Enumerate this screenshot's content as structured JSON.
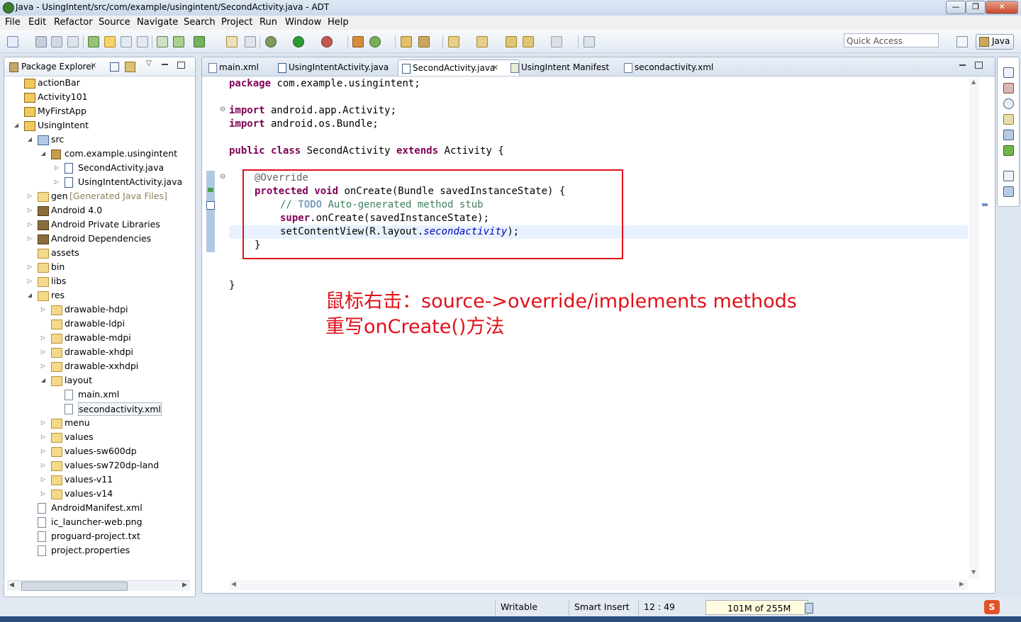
{
  "window": {
    "title": "Java - UsingIntent/src/com/example/usingintent/SecondActivity.java - ADT",
    "minimize": "—",
    "restore": "❐",
    "close": "✕"
  },
  "menubar": [
    "File",
    "Edit",
    "Refactor",
    "Source",
    "Navigate",
    "Search",
    "Project",
    "Run",
    "Window",
    "Help"
  ],
  "toolbar": {
    "quick_access_placeholder": "Quick Access",
    "perspective": "Java"
  },
  "package_explorer": {
    "title": "Package Explorer",
    "close": "✕",
    "tree": [
      {
        "label": "actionBar",
        "kind": "project"
      },
      {
        "label": "Activity101",
        "kind": "project"
      },
      {
        "label": "MyFirstApp",
        "kind": "project"
      },
      {
        "label": "UsingIntent",
        "kind": "project"
      },
      {
        "label": "src",
        "kind": "srcfolder"
      },
      {
        "label": "com.example.usingintent",
        "kind": "package"
      },
      {
        "label": "SecondActivity.java",
        "kind": "java"
      },
      {
        "label": "UsingIntentActivity.java",
        "kind": "java"
      },
      {
        "label": "gen",
        "kind": "folder",
        "suffix": "[Generated Java Files]"
      },
      {
        "label": "Android 4.0",
        "kind": "lib"
      },
      {
        "label": "Android Private Libraries",
        "kind": "lib"
      },
      {
        "label": "Android Dependencies",
        "kind": "lib"
      },
      {
        "label": "assets",
        "kind": "folder"
      },
      {
        "label": "bin",
        "kind": "folder"
      },
      {
        "label": "libs",
        "kind": "folder"
      },
      {
        "label": "res",
        "kind": "folder"
      },
      {
        "label": "drawable-hdpi",
        "kind": "folder"
      },
      {
        "label": "drawable-ldpi",
        "kind": "folder"
      },
      {
        "label": "drawable-mdpi",
        "kind": "folder"
      },
      {
        "label": "drawable-xhdpi",
        "kind": "folder"
      },
      {
        "label": "drawable-xxhdpi",
        "kind": "folder"
      },
      {
        "label": "layout",
        "kind": "folder"
      },
      {
        "label": "main.xml",
        "kind": "file"
      },
      {
        "label": "secondactivity.xml",
        "kind": "file"
      },
      {
        "label": "menu",
        "kind": "folder"
      },
      {
        "label": "values",
        "kind": "folder"
      },
      {
        "label": "values-sw600dp",
        "kind": "folder"
      },
      {
        "label": "values-sw720dp-land",
        "kind": "folder"
      },
      {
        "label": "values-v11",
        "kind": "folder"
      },
      {
        "label": "values-v14",
        "kind": "folder"
      },
      {
        "label": "AndroidManifest.xml",
        "kind": "file"
      },
      {
        "label": "ic_launcher-web.png",
        "kind": "file"
      },
      {
        "label": "proguard-project.txt",
        "kind": "file"
      },
      {
        "label": "project.properties",
        "kind": "file"
      }
    ]
  },
  "editor": {
    "tabs": [
      {
        "label": "main.xml"
      },
      {
        "label": "UsingIntentActivity.java"
      },
      {
        "label": "SecondActivity.java",
        "active": true,
        "close": "✕"
      },
      {
        "label": "UsingIntent Manifest"
      },
      {
        "label": "secondactivity.xml"
      }
    ],
    "code": {
      "l1_kw": "package",
      "l1_rest": " com.example.usingintent;",
      "l3_kw": "import",
      "l3_rest": " android.app.Activity;",
      "l4_kw": "import",
      "l4_rest": " android.os.Bundle;",
      "l6_kw1": "public class",
      "l6_mid": " SecondActivity ",
      "l6_kw2": "extends",
      "l6_rest": " Activity {",
      "l8_an": "@Override",
      "l9_kw": "protected void",
      "l9_rest": " onCreate(Bundle savedInstanceState) {",
      "l10_cm1": "// ",
      "l10_todo": "TODO",
      "l10_cm2": " Auto-generated method stub",
      "l11_kw": "super",
      "l11_rest": ".onCreate(savedInstanceState);",
      "l12_a": "setContentView(R.layout.",
      "l12_it": "secondactivity",
      "l12_b": ");",
      "l13": "}",
      "l15": "}"
    },
    "annotation_line1": "鼠标右击：source->override/implements methods",
    "annotation_line2": "重写onCreate()方法",
    "annotation_color": "#e0101a"
  },
  "statusbar": {
    "writable": "Writable",
    "insert_mode": "Smart Insert",
    "position": "12 : 49",
    "heap": "101M of 255M"
  }
}
